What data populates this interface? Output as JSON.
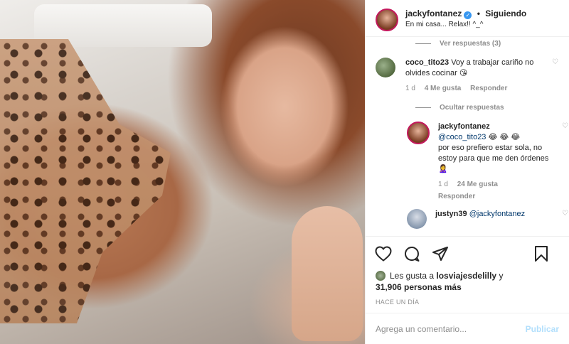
{
  "post": {
    "header": {
      "username": "jackyfontanez",
      "dot": "•",
      "follow_label": "Siguiendo",
      "caption": "En mi casa... Relax!! ^_^"
    },
    "comments_section": {
      "view_replies_label": "Ver respuestas (3)",
      "comment": {
        "username": "coco_tito23",
        "text": "Voy a trabajar cariño no olvides cocinar 😘",
        "age": "1 d",
        "likes": "4 Me gusta",
        "reply_label": "Responder"
      },
      "hide_replies_label": "Ocultar respuestas",
      "reply": {
        "username": "jackyfontanez",
        "mention": "@coco_tito23",
        "emojis": " 😂 😂 😂",
        "text": "por eso prefiero estar sola, no estoy para que me den órdenes 🙎‍♀️",
        "age": "1 d",
        "likes": "24 Me gusta",
        "reply_label": "Responder"
      },
      "next_reply": {
        "username": "justyn39",
        "mention": "@jackyfontanez"
      }
    },
    "likes": {
      "prefix": "Les gusta a",
      "liker": "losviajesdelilly",
      "connector": "y",
      "count": "31,906 personas más"
    },
    "time_ago": "HACE UN DÍA",
    "add_comment": {
      "placeholder": "Agrega un comentario...",
      "publish_label": "Publicar"
    }
  }
}
